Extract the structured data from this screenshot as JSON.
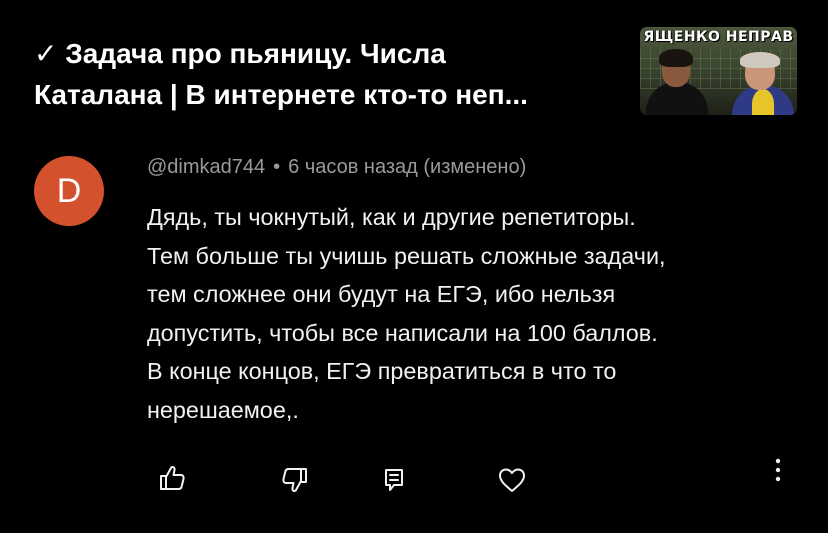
{
  "video": {
    "title_line1": "✓ Задача про пьяницу. Числа",
    "title_line2": "Каталана | В интернете кто-то неп...",
    "thumbnail_text": "ЯЩЕНКО НЕПРАВ"
  },
  "comment": {
    "avatar_letter": "D",
    "author": "@dimkad744",
    "separator": "•",
    "timestamp": "6 часов назад (изменено)",
    "text_lines": [
      "Дядь, ты чокнутый, как и другие репетиторы.",
      "Тем больше ты учишь решать сложные задачи,",
      "тем сложнее они будут на ЕГЭ, ибо нельзя",
      "допустить, чтобы все написали на 100 баллов.",
      "В конце концов, ЕГЭ превратиться в что то",
      "нерешаемое,."
    ],
    "avatar_color": "#d4512e"
  },
  "actions": {
    "like_icon": "thumbs-up-icon",
    "dislike_icon": "thumbs-down-icon",
    "reply_icon": "reply-comment-icon",
    "heart_icon": "heart-icon",
    "more_icon": "more-vertical-icon"
  }
}
